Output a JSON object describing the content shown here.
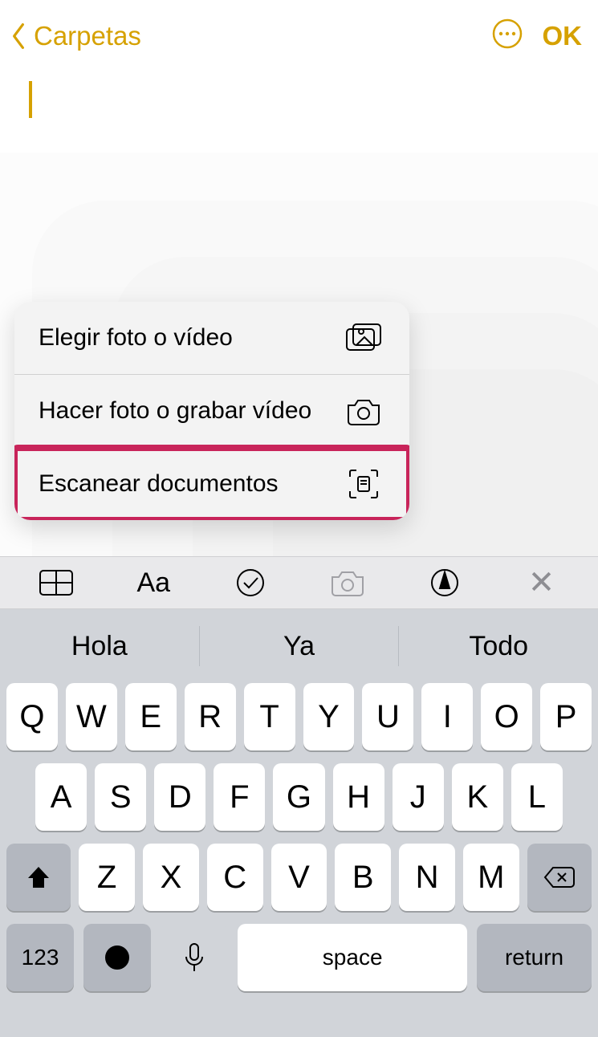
{
  "nav": {
    "back_label": "Carpetas",
    "done_label": "OK"
  },
  "popup": {
    "choose": "Elegir foto o vídeo",
    "take": "Hacer foto o grabar vídeo",
    "scan": "Escanear documentos"
  },
  "toolbar": {
    "text_style": "Aa"
  },
  "suggestions": [
    "Hola",
    "Ya",
    "Todo"
  ],
  "keyboard": {
    "row1": [
      "Q",
      "W",
      "E",
      "R",
      "T",
      "Y",
      "U",
      "I",
      "O",
      "P"
    ],
    "row2": [
      "A",
      "S",
      "D",
      "F",
      "G",
      "H",
      "J",
      "K",
      "L"
    ],
    "row3": [
      "Z",
      "X",
      "C",
      "V",
      "B",
      "N",
      "M"
    ],
    "numbers": "123",
    "space": "space",
    "return": "return"
  },
  "colors": {
    "accent": "#d6a100",
    "highlight": "#c8245a"
  }
}
